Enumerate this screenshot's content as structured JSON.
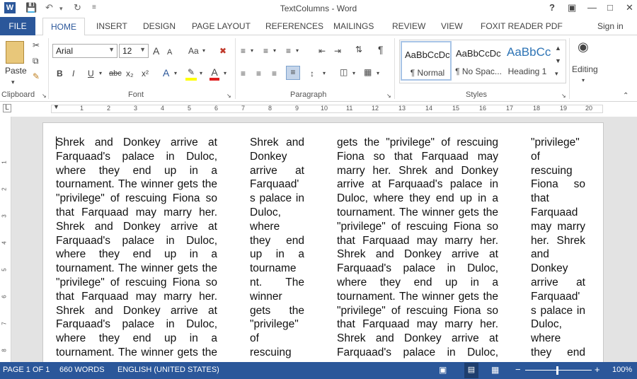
{
  "window": {
    "title": "TextColumns - Word",
    "help": "?",
    "sign_in": "Sign in"
  },
  "tabs": {
    "file": "FILE",
    "items": [
      "HOME",
      "INSERT",
      "DESIGN",
      "PAGE LAYOUT",
      "REFERENCES",
      "MAILINGS",
      "REVIEW",
      "VIEW",
      "FOXIT READER PDF"
    ]
  },
  "ribbon": {
    "clipboard": {
      "paste": "Paste",
      "label": "Clipboard"
    },
    "font": {
      "name": "Arial",
      "size": "12",
      "label": "Font",
      "bold": "B",
      "italic": "I",
      "underline": "U",
      "strike": "abc",
      "sub": "x₂",
      "sup": "x²",
      "grow": "A",
      "shrink": "A",
      "case": "Aa"
    },
    "paragraph": {
      "label": "Paragraph",
      "pilcrow": "¶"
    },
    "styles": {
      "label": "Styles",
      "items": [
        {
          "preview": "AaBbCcDc",
          "name": "¶ Normal"
        },
        {
          "preview": "AaBbCcDc",
          "name": "¶ No Spac..."
        },
        {
          "preview": "AaBbCc",
          "name": "Heading 1"
        }
      ]
    },
    "editing": {
      "label": "Editing"
    }
  },
  "ruler": {
    "h_numbers": [
      "1",
      "2",
      "3",
      "4",
      "5",
      "6",
      "7",
      "8",
      "9",
      "10",
      "11",
      "12",
      "13",
      "14",
      "15",
      "16",
      "17",
      "18",
      "19",
      "20"
    ],
    "v_numbers": [
      "1",
      "2",
      "3",
      "4",
      "5",
      "6",
      "7",
      "8"
    ]
  },
  "document": {
    "columns": [
      [
        "Shrek and Donkey arrive at",
        "Farquaad's palace in Duloc,",
        "where they end up in a",
        "tournament. The winner gets the",
        "\"privilege\" of rescuing Fiona so",
        "that Farquaad may marry her.",
        "Shrek and Donkey arrive at",
        "Farquaad's palace in Duloc,",
        "where they end up in a",
        "tournament. The winner gets the",
        "\"privilege\" of rescuing Fiona so",
        "that Farquaad may marry her.",
        "Shrek and Donkey arrive at",
        "Farquaad's palace in Duloc,",
        "where they end up in a",
        "tournament. The winner gets the"
      ],
      [
        "Shrek and",
        "Donkey",
        "arrive at",
        "Farquaad'",
        "s palace in",
        "Duloc,",
        "where",
        "they end",
        "up in a",
        "tourname",
        "nt. The",
        "winner",
        "gets the",
        "\"privilege\"",
        "of",
        "rescuing"
      ],
      [
        "gets the \"privilege\" of rescuing",
        "Fiona so that Farquaad may",
        "marry her. Shrek and Donkey",
        "arrive at Farquaad's palace in",
        "Duloc, where they end up in a",
        "tournament. The winner gets the",
        "\"privilege\" of rescuing Fiona so",
        "that Farquaad may marry her.",
        "Shrek and Donkey arrive at",
        "Farquaad's palace in Duloc,",
        "where they end up in a",
        "tournament. The winner gets the",
        "\"privilege\" of rescuing Fiona so",
        "that Farquaad may marry her.",
        "Shrek and Donkey arrive at",
        "Farquaad's palace in Duloc,"
      ],
      [
        "\"privilege\"",
        "of",
        "rescuing",
        "Fiona so",
        "that",
        "Farquaad",
        "may marry",
        "her. Shrek",
        "and",
        "Donkey",
        "arrive at",
        "Farquaad'",
        "s palace in",
        "Duloc,",
        "where",
        "they end"
      ]
    ]
  },
  "statusbar": {
    "page": "PAGE 1 OF 1",
    "words": "660 WORDS",
    "language": "ENGLISH (UNITED STATES)",
    "zoom": "100%"
  },
  "colors": {
    "accent": "#2b579a"
  }
}
